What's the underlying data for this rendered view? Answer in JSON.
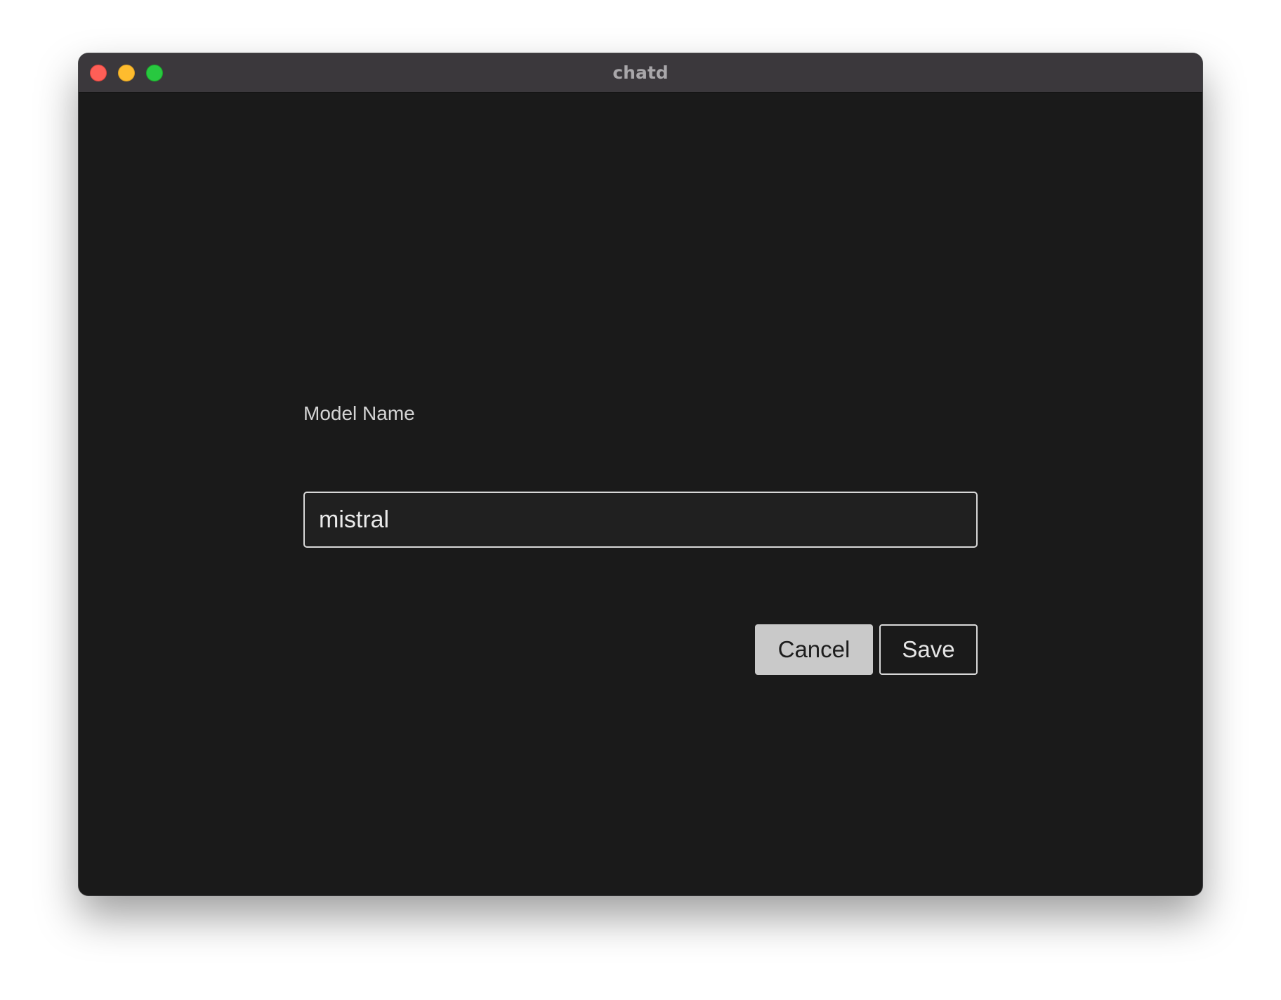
{
  "window": {
    "title": "chatd"
  },
  "form": {
    "model_name_label": "Model Name",
    "model_name_value": "mistral",
    "cancel_label": "Cancel",
    "save_label": "Save"
  },
  "colors": {
    "titlebar": "#3b383c",
    "background": "#1a1a1a",
    "close": "#fe5f57",
    "minimize": "#febc2e",
    "maximize": "#28c840",
    "cancel_button": "#c9c9c9"
  }
}
